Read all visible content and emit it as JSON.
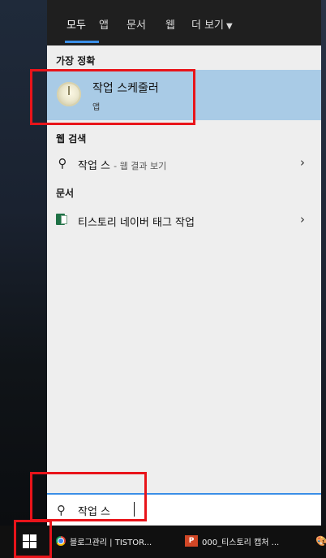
{
  "nav": {
    "tabs": [
      {
        "label": "모두",
        "active": true
      },
      {
        "label": "앱"
      },
      {
        "label": "문서"
      },
      {
        "label": "웹"
      },
      {
        "label": "더 보기"
      }
    ]
  },
  "best_match": {
    "header": "가장 정확",
    "app_name": "작업 스케줄러",
    "app_type": "앱",
    "icon": "clock-icon"
  },
  "web_search": {
    "header": "웹 검색",
    "query": "작업 스",
    "suffix": "- 웹 결과 보기",
    "icon": "search-icon"
  },
  "documents": {
    "header": "문서",
    "items": [
      {
        "title": "티스토리 네이버 태그 작업",
        "icon": "excel-file-icon"
      }
    ]
  },
  "search_box": {
    "value": "작업 스",
    "icon": "search-icon"
  },
  "taskbar": {
    "items": [
      {
        "label": "블로그관리 | TISTOR...",
        "icon": "chrome-icon"
      },
      {
        "label": "000_티스토리 캡처 ...",
        "icon": "powerpoint-icon",
        "badge": "P"
      }
    ]
  },
  "colors": {
    "highlight": "#e8141a",
    "selection": "#a9cbe6",
    "accent": "#3a8ee6"
  }
}
